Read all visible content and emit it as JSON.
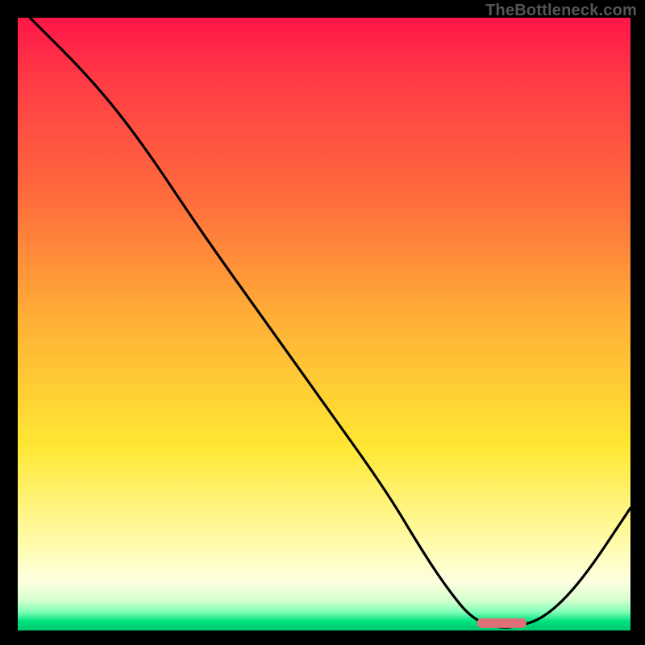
{
  "watermark": "TheBottleneck.com",
  "colors": {
    "gradient_top": "#ff1648",
    "gradient_mid1": "#ff6e3c",
    "gradient_mid2": "#ffe733",
    "gradient_bottom": "#00c86f",
    "curve": "#000000",
    "marker": "#e07078"
  },
  "chart_data": {
    "type": "line",
    "title": "",
    "xlabel": "",
    "ylabel": "",
    "xlim": [
      0,
      100
    ],
    "ylim": [
      0,
      100
    ],
    "grid": false,
    "legend": false,
    "series": [
      {
        "name": "bottleneck-curve",
        "x": [
          2,
          12,
          20,
          30,
          40,
          50,
          60,
          66,
          70,
          74,
          78,
          81,
          86,
          92,
          100
        ],
        "y": [
          100,
          90,
          80,
          65,
          51,
          37,
          23,
          13,
          7,
          2,
          0.5,
          0.5,
          2,
          8,
          20
        ]
      }
    ],
    "markers": [
      {
        "name": "optimal-zone",
        "x_start": 75,
        "x_end": 83,
        "y": 1.2,
        "width": 8
      }
    ],
    "annotations": []
  }
}
